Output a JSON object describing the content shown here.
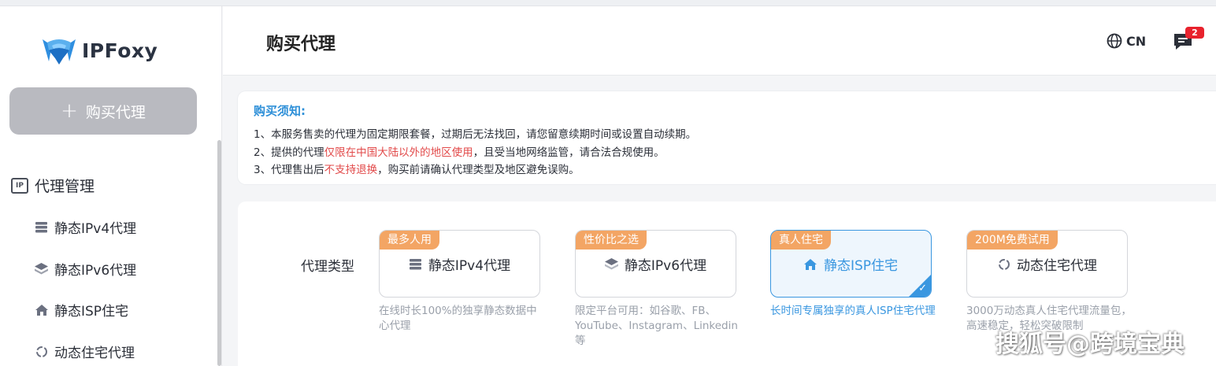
{
  "app": {
    "name": "IPFoxy"
  },
  "sidebar": {
    "buy_button": "购买代理",
    "section_title": "代理管理",
    "items": [
      {
        "label": "静态IPv4代理",
        "icon": "server-icon"
      },
      {
        "label": "静态IPv6代理",
        "icon": "layers-icon"
      },
      {
        "label": "静态ISP住宅",
        "icon": "home-icon"
      },
      {
        "label": "动态住宅代理",
        "icon": "refresh-icon"
      }
    ]
  },
  "header": {
    "title": "购买代理",
    "language": "CN",
    "message_count": "2"
  },
  "notice": {
    "title": "购买须知:",
    "line1": "1、本服务售卖的代理为固定期限套餐，过期后无法找回，请您留意续期时间或设置自动续期。",
    "line2_a": "2、提供的代理",
    "line2_red": "仅限在中国大陆以外的地区使用",
    "line2_b": "，且受当地网络监管，请合法合规使用。",
    "line3_a": "3、代理售出后",
    "line3_red": "不支持退换",
    "line3_b": "，购买前请确认代理类型及地区避免误购。"
  },
  "proxy_type": {
    "label": "代理类型",
    "options": [
      {
        "tag": "最多人用",
        "name": "静态IPv4代理",
        "desc": "在线时长100%的独享静态数据中心代理",
        "selected": false
      },
      {
        "tag": "性价比之选",
        "name": "静态IPv6代理",
        "desc": "限定平台可用：如谷歌、FB、YouTube、Instagram、Linkedin等",
        "selected": false
      },
      {
        "tag": "真人住宅",
        "name": "静态ISP住宅",
        "desc": "长时间专属独享的真人ISP住宅代理",
        "selected": true
      },
      {
        "tag": "200M免费试用",
        "name": "动态住宅代理",
        "desc": "3000万动态真人住宅代理流量包，高速稳定，轻松突破限制",
        "selected": false
      }
    ]
  },
  "watermark": "搜狐号@跨境宝典",
  "colors": {
    "accent": "#3a97e0",
    "tag": "#f3a564",
    "warning": "#e24a4a",
    "badge": "#e8222d"
  }
}
